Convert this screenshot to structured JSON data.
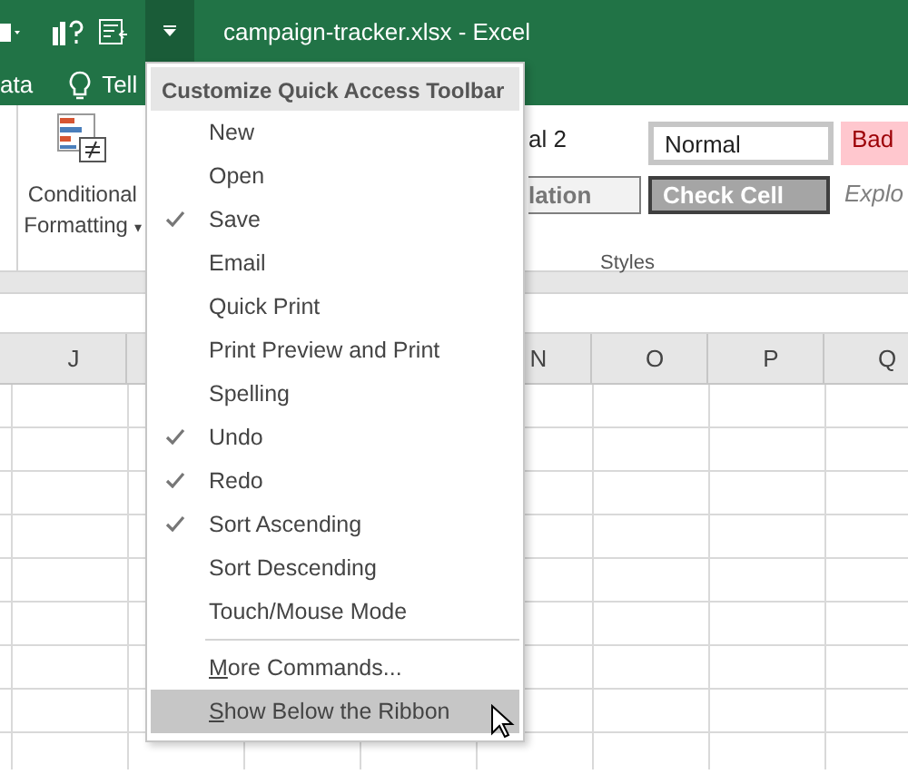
{
  "window": {
    "title": "campaign-tracker.xlsx - Excel"
  },
  "ribbon_tabs": [
    {
      "label": "ata",
      "kind": "text"
    },
    {
      "label": "Tell",
      "kind": "tell"
    }
  ],
  "conditional_formatting": {
    "line_1": "Conditional",
    "line_2": "Formatting",
    "caret": "▾"
  },
  "styles": {
    "cells": [
      {
        "text": "al 2",
        "kind": "plain"
      },
      {
        "text": "Normal",
        "kind": "normal"
      },
      {
        "text": "Bad",
        "kind": "bad"
      },
      {
        "text": "lation",
        "kind": "calc"
      },
      {
        "text": "Check Cell",
        "kind": "check"
      },
      {
        "text": "Explo",
        "kind": "explanatory"
      }
    ],
    "group_label": "Styles"
  },
  "columns": [
    "J",
    "",
    "",
    "",
    "N",
    "O",
    "P",
    "Q"
  ],
  "menu": {
    "header": "Customize Quick Access Toolbar",
    "items": [
      {
        "label": "New",
        "checked": false,
        "selected": false,
        "kind": "item"
      },
      {
        "label": "Open",
        "checked": false,
        "selected": false,
        "kind": "item"
      },
      {
        "label": "Save",
        "checked": true,
        "selected": false,
        "kind": "item"
      },
      {
        "label": "Email",
        "checked": false,
        "selected": false,
        "kind": "item"
      },
      {
        "label": "Quick Print",
        "checked": false,
        "selected": false,
        "kind": "item"
      },
      {
        "label": "Print Preview and Print",
        "checked": false,
        "selected": false,
        "kind": "item"
      },
      {
        "label": "Spelling",
        "checked": false,
        "selected": false,
        "kind": "item"
      },
      {
        "label": "Undo",
        "checked": true,
        "selected": false,
        "kind": "item"
      },
      {
        "label": "Redo",
        "checked": true,
        "selected": false,
        "kind": "item"
      },
      {
        "label": "Sort Ascending",
        "checked": true,
        "selected": false,
        "kind": "item"
      },
      {
        "label": "Sort Descending",
        "checked": false,
        "selected": false,
        "kind": "item"
      },
      {
        "label": "Touch/Mouse Mode",
        "checked": false,
        "selected": false,
        "kind": "item"
      },
      {
        "kind": "separator"
      },
      {
        "label": "More Commands...",
        "mnemonic": true,
        "selected": false,
        "kind": "command"
      },
      {
        "label": "Show Below the Ribbon",
        "mnemonic": true,
        "selected": true,
        "kind": "command"
      }
    ]
  }
}
